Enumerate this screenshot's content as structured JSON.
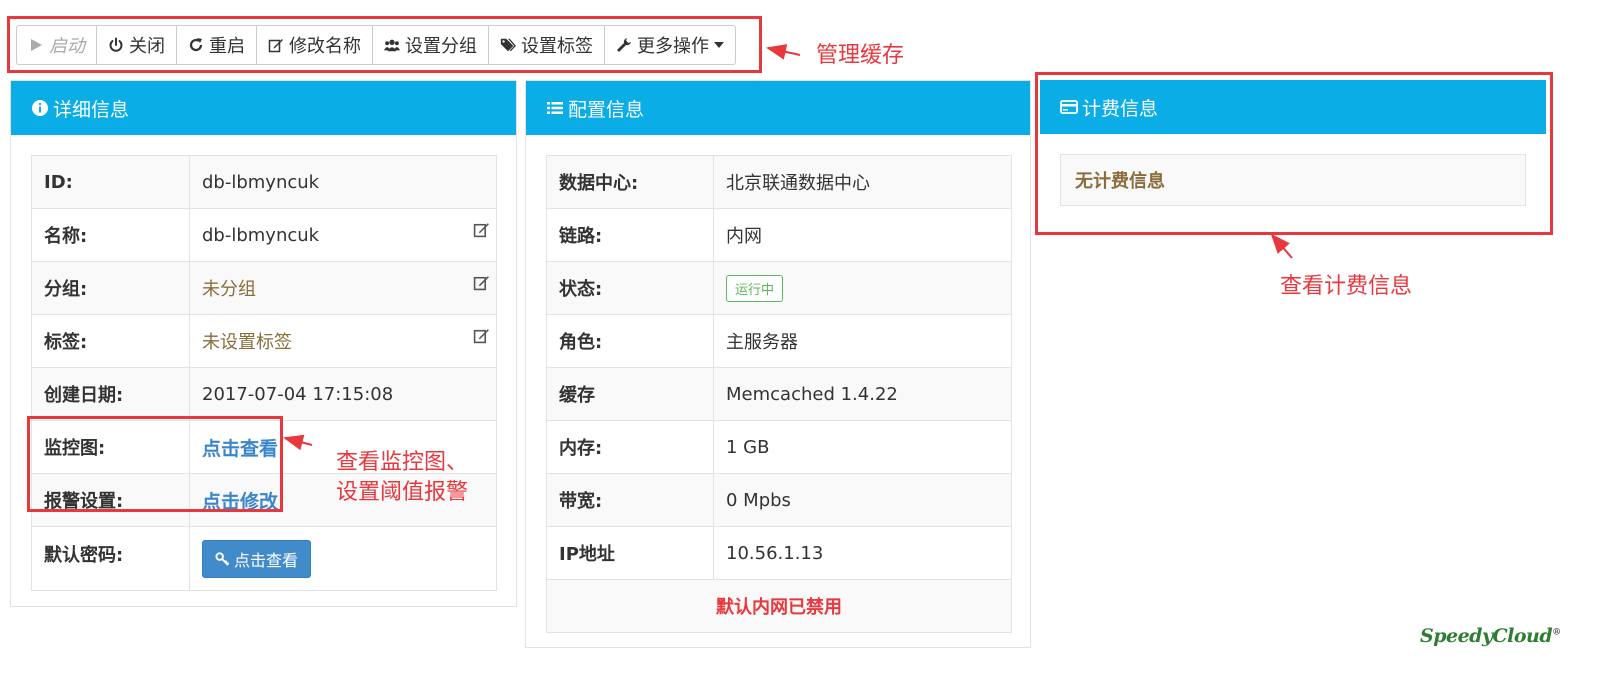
{
  "toolbar": {
    "start": "启动",
    "shutdown": "关闭",
    "restart": "重启",
    "rename": "修改名称",
    "set_group": "设置分组",
    "set_tags": "设置标签",
    "more": "更多操作"
  },
  "annotations": {
    "manage_cache": "管理缓存",
    "monitor_line1": "查看监控图、",
    "monitor_line2": "设置阈值报警",
    "billing": "查看计费信息"
  },
  "details": {
    "title": "详细信息",
    "rows": [
      {
        "label": "ID:",
        "value": "db-lbmyncuk"
      },
      {
        "label": "名称:",
        "value": "db-lbmyncuk"
      },
      {
        "label": "分组:",
        "value": "未分组"
      },
      {
        "label": "标签:",
        "value": "未设置标签"
      },
      {
        "label": "创建日期:",
        "value": "2017-07-04 17:15:08"
      },
      {
        "label": "监控图:",
        "value": "点击查看"
      },
      {
        "label": "报警设置:",
        "value": "点击修改"
      },
      {
        "label": "默认密码:",
        "value": "点击查看"
      }
    ]
  },
  "config": {
    "title": "配置信息",
    "rows": [
      {
        "label": "数据中心:",
        "value": "北京联通数据中心"
      },
      {
        "label": "链路:",
        "value": "内网"
      },
      {
        "label": "状态:",
        "value": "运行中"
      },
      {
        "label": "角色:",
        "value": "主服务器"
      },
      {
        "label": "缓存",
        "value": "Memcached 1.4.22"
      },
      {
        "label": "内存:",
        "value": "1 GB"
      },
      {
        "label": "带宽:",
        "value": "0 Mpbs"
      },
      {
        "label": "IP地址",
        "value": "10.56.1.13"
      }
    ],
    "footer_warning": "默认内网已禁用"
  },
  "billing": {
    "title": "计费信息",
    "empty_text": "无计费信息"
  },
  "logo": {
    "text": "SpeedyCloud",
    "mark": "®"
  },
  "colors": {
    "panel_header": "#0aade6",
    "annotation_red": "#e8383d",
    "link_blue": "#3a86cc",
    "muted_tan": "#8a6d3b",
    "status_green": "#5cb85c"
  },
  "icons": [
    "play-icon",
    "power-icon",
    "refresh-icon",
    "edit-icon",
    "users-icon",
    "tags-icon",
    "wrench-icon",
    "info-icon",
    "list-icon",
    "credit-card-icon",
    "key-icon"
  ]
}
